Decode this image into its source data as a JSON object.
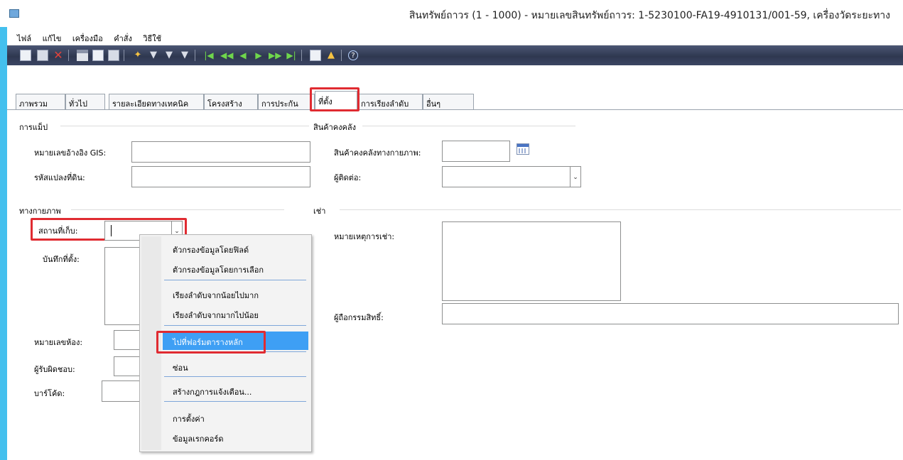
{
  "window": {
    "title": "สินทรัพย์ถาวร (1 - 1000) - หมายเลขสินทรัพย์ถาวร: 1-5230100-FA19-4910131/001-59, เครื่องวัดระยะทาง"
  },
  "menubar": [
    "ไฟล์",
    "แก้ไข",
    "เครื่องมือ",
    "คำสั่ง",
    "วิธีใช้"
  ],
  "toolbar": {
    "icons": [
      "new-icon",
      "save-icon",
      "delete-icon",
      "print-icon",
      "print-preview-icon",
      "export-icon",
      "filter-icon",
      "filter-by-selection-icon",
      "advanced-filter-icon",
      "remove-filter-icon",
      "first-record-icon",
      "previous-page-icon",
      "previous-record-icon",
      "next-record-icon",
      "next-page-icon",
      "last-record-icon",
      "attachment-icon",
      "alert-icon",
      "help-icon"
    ]
  },
  "tabs": [
    "ภาพรวม",
    "ทั่วไป",
    "รายละเอียดทางเทคนิค",
    "โครงสร้าง",
    "การประกัน",
    "ที่ตั้ง",
    "การเรียงลำดับ",
    "อื่นๆ"
  ],
  "active_tab": "ที่ตั้ง",
  "groups": {
    "mapping": {
      "title": "การแม็ป",
      "gis_label": "หมายเลขอ้างอิง GIS:",
      "gis_value": "",
      "parcel_label": "รหัสแปลงที่ดิน:",
      "parcel_value": ""
    },
    "physical": {
      "title": "ทางกายภาพ",
      "location_label": "สถานที่เก็บ:",
      "location_value": "",
      "note_label": "บันทึกที่ตั้ง:",
      "room_label": "หมายเลขห้อง:",
      "responsible_label": "ผู้รับผิดชอบ:",
      "barcode_label": "บาร์โค้ด:"
    },
    "inventory": {
      "title": "สินค้าคงคลัง",
      "physical_inventory_label": "สินค้าคงคลังทางกายภาพ:",
      "physical_inventory_value": "",
      "contact_label": "ผู้ติดต่อ:",
      "contact_value": ""
    },
    "lease": {
      "title": "เช่า",
      "lease_note_label": "หมายเหตุการเช่า:",
      "lease_note_value": "",
      "owner_label": "ผู้ถือกรรมสิทธิ์:",
      "owner_value": ""
    }
  },
  "context_menu": {
    "items": [
      "ตัวกรองข้อมูลโดยฟิลด์",
      "ตัวกรองข้อมูลโดยการเลือก",
      "เรียงลำดับจากน้อยไปมาก",
      "เรียงลำดับจากมากไปน้อย",
      "ไปที่ฟอร์มตารางหลัก",
      "ซ่อน",
      "สร้างกฎการแจ้งเตือน...",
      "การตั้งค่า",
      "ข้อมูลเรกคอร์ด"
    ],
    "selected": "ไปที่ฟอร์มตารางหลัก"
  },
  "colors": {
    "highlight": "#e02b31",
    "menu_selection": "#3e9ff4",
    "toolbar": "#2f3850",
    "frame": "#44c0ee"
  }
}
